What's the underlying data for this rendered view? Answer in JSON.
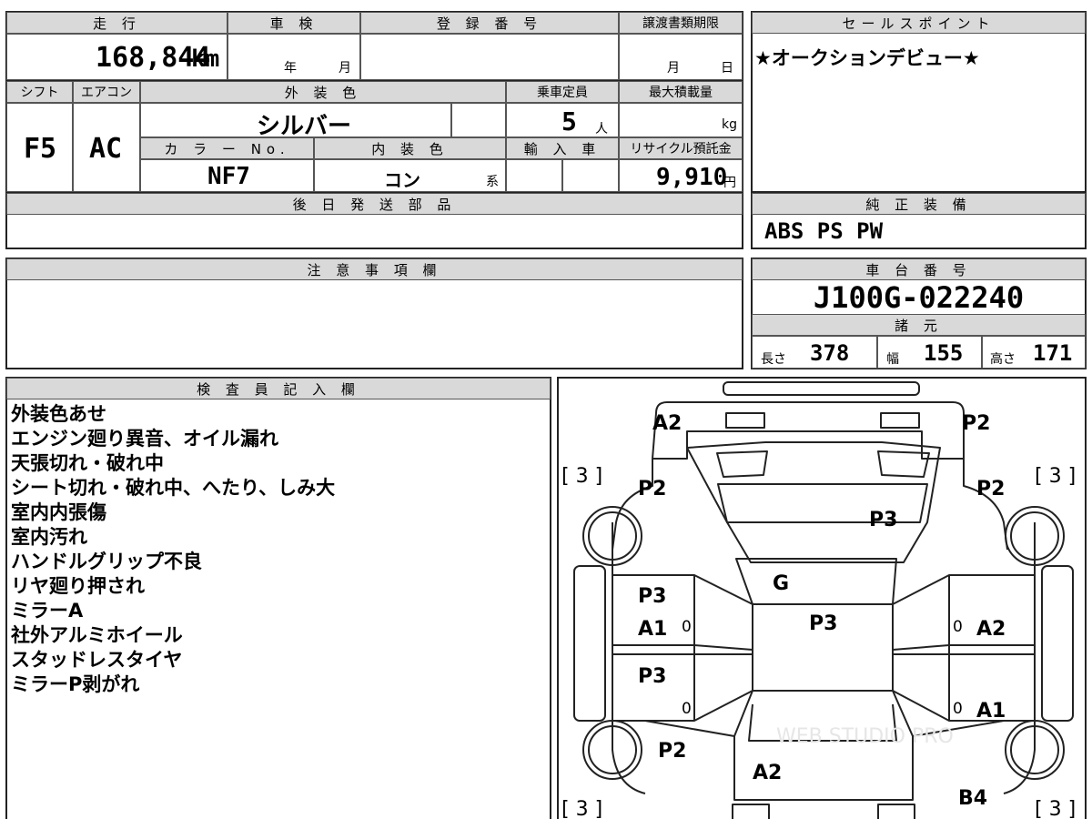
{
  "summary": {
    "mileage_header": "走 行",
    "mileage_value": "168,844",
    "mileage_unit": "km",
    "inspection_header": "車 検",
    "inspection_year_unit": "年",
    "inspection_month_unit": "月",
    "registration_header": "登 録 番 号",
    "registration_value": "",
    "transfer_header": "譲渡書類期限",
    "transfer_month_unit": "月",
    "transfer_day_unit": "日"
  },
  "specs": {
    "shift_header": "シフト",
    "shift_value": "F5",
    "ac_header": "エアコン",
    "ac_value": "AC",
    "exterior_header": "外 装 色",
    "exterior_value": "シルバー",
    "capacity_header": "乗車定員",
    "capacity_value": "5",
    "capacity_unit": "人",
    "maxload_header": "最大積載量",
    "maxload_unit": "kg",
    "color_no_header": "カ ラ ー No.",
    "color_no_value": "NF7",
    "interior_header": "内 装 色",
    "interior_value": "コン",
    "interior_suffix": "系",
    "import_header": "輸 入 車",
    "recycle_header": "リサイクル預託金",
    "recycle_value": "9,910",
    "recycle_unit": "円"
  },
  "later_parts": {
    "header": "後 日 発 送 部 品",
    "value": ""
  },
  "sales_point": {
    "header": "セールスポイント",
    "value": "★オークションデビュー★"
  },
  "equipment": {
    "header": "純 正 装 備",
    "value": "ABS PS PW"
  },
  "caution": {
    "header": "注 意 事 項 欄",
    "value": ""
  },
  "chassis": {
    "header": "車 台 番 号",
    "value": "J100G-022240"
  },
  "dimensions": {
    "header": "諸 元",
    "length_label": "長さ",
    "length_value": "378",
    "width_label": "幅",
    "width_value": "155",
    "height_label": "高さ",
    "height_value": "171"
  },
  "inspector": {
    "header": "検 査 員 記 入 欄",
    "notes": [
      "外装色あせ",
      "エンジン廻り異音、オイル漏れ",
      "天張切れ・破れ中",
      "シート切れ・破れ中、へたり、しみ大",
      "室内内張傷",
      "室内汚れ",
      "ハンドルグリップ不良",
      "リヤ廻り押され",
      "ミラーA",
      "社外アルミホイール",
      "スタッドレスタイヤ",
      "ミラーP剥がれ"
    ]
  },
  "diagram": {
    "front_left": "A2",
    "front_right": "P2",
    "tire_fl": "[ 3 ]",
    "tire_fr": "[ 3 ]",
    "tire_rl": "[ 3 ]",
    "tire_rr": "[ 3 ]",
    "fender_fl": "P2",
    "fender_fr": "P2",
    "hood": "P3",
    "windshield": "G",
    "roof": "P3",
    "door_fl_top": "P3",
    "door_fl_bottom": "A1",
    "door_fl_zero": "0",
    "door_fr_zero": "0",
    "door_fr": "A2",
    "door_rl": "P3",
    "door_rl_zero": "0",
    "door_rr_zero": "0",
    "door_rr": "A1",
    "quarter_rl": "P2",
    "rear": "A2",
    "quarter_rr": "B4",
    "watermark": "WEB STUDIO PRO"
  }
}
